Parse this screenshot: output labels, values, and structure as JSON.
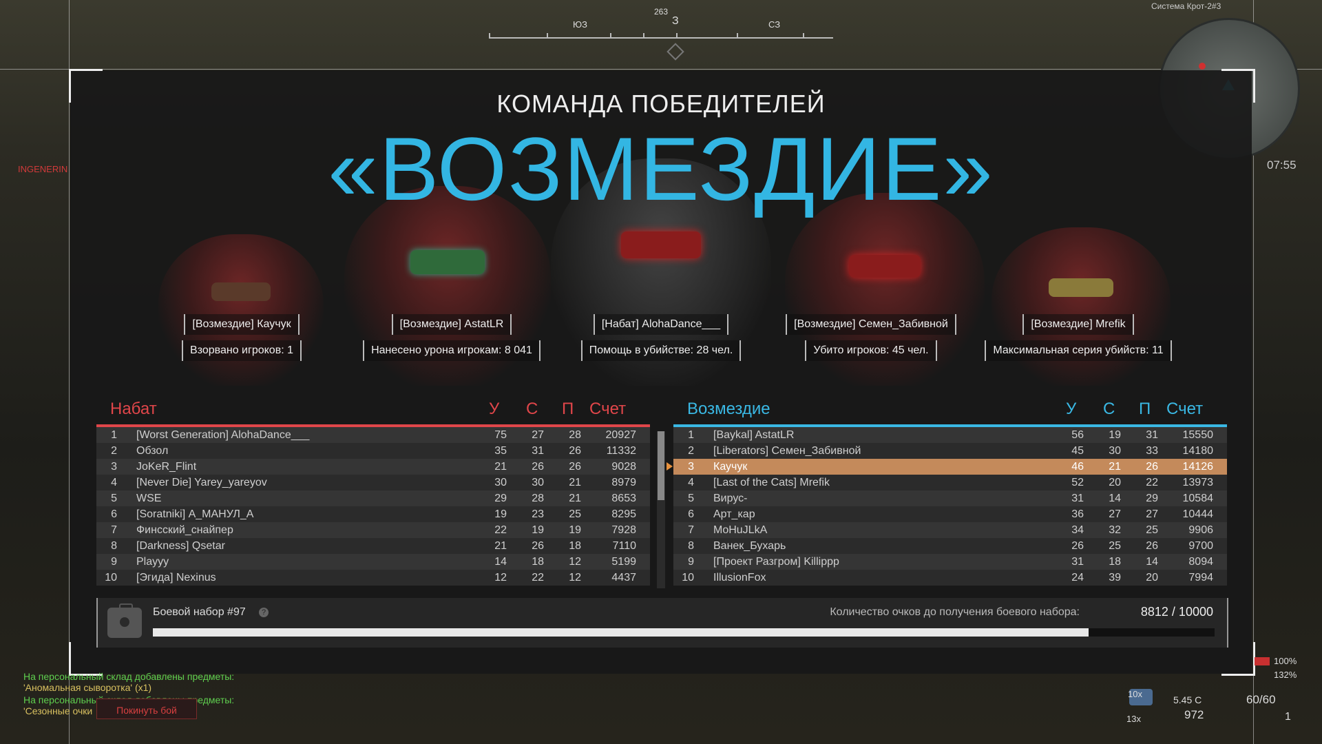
{
  "hud": {
    "compass": {
      "heading_deg": "263",
      "heading_label": "З",
      "left_label": "ЮЗ",
      "right_label": "СЗ"
    },
    "minimap_title": "Система Крот-2#3",
    "clock": "07:55",
    "side_label": "INGENERIN",
    "health_pct": "100%",
    "armor_pct": "132%",
    "grenade_count": "10x",
    "medkit_count": "13x",
    "ammo_type": "5.45 С",
    "ammo_reserve": "972",
    "ammo_mag": "60/60",
    "slot_count": "1"
  },
  "victory": {
    "subtitle": "КОМАНДА ПОБЕДИТЕЛЕЙ",
    "team": "«ВОЗМЕЗДИЕ»"
  },
  "highlights": [
    {
      "name": "[Возмездие] Каучук",
      "stat": "Взорвано игроков: 1"
    },
    {
      "name": "[Возмездие] AstatLR",
      "stat": "Нанесено урона игрокам: 8 041"
    },
    {
      "name": "[Набат] AlohaDance___",
      "stat": "Помощь в убийстве: 28 чел."
    },
    {
      "name": "[Возмездие] Семен_Забивной",
      "stat": "Убито игроков: 45 чел."
    },
    {
      "name": "[Возмездие] Mrefik",
      "stat": "Максимальная серия убийств: 11"
    }
  ],
  "columns": {
    "kills": "У",
    "deaths": "С",
    "assists": "П",
    "score": "Счет"
  },
  "teams": [
    {
      "name": "Набат",
      "color": "#e0464a",
      "rows": [
        {
          "rank": "1",
          "name": "[Worst Generation] AlohaDance___",
          "k": "75",
          "d": "27",
          "a": "28",
          "s": "20927"
        },
        {
          "rank": "2",
          "name": "Обзол",
          "k": "35",
          "d": "31",
          "a": "26",
          "s": "11332"
        },
        {
          "rank": "3",
          "name": "JoKeR_Flint",
          "k": "21",
          "d": "26",
          "a": "26",
          "s": "9028"
        },
        {
          "rank": "4",
          "name": "[Never Die] Yarey_yareyov",
          "k": "30",
          "d": "30",
          "a": "21",
          "s": "8979"
        },
        {
          "rank": "5",
          "name": "WSE",
          "k": "29",
          "d": "28",
          "a": "21",
          "s": "8653"
        },
        {
          "rank": "6",
          "name": "[Soratniki] А_МАНУЛ_А",
          "k": "19",
          "d": "23",
          "a": "25",
          "s": "8295"
        },
        {
          "rank": "7",
          "name": "Финсский_снайпер",
          "k": "22",
          "d": "19",
          "a": "19",
          "s": "7928"
        },
        {
          "rank": "8",
          "name": "[Darkness] Qsetar",
          "k": "21",
          "d": "26",
          "a": "18",
          "s": "7110"
        },
        {
          "rank": "9",
          "name": "Playyy",
          "k": "14",
          "d": "18",
          "a": "12",
          "s": "5199"
        },
        {
          "rank": "10",
          "name": "[Эгида] Nexinus",
          "k": "12",
          "d": "22",
          "a": "12",
          "s": "4437"
        }
      ]
    },
    {
      "name": "Возмездие",
      "color": "#3ab8e4",
      "rows": [
        {
          "rank": "1",
          "name": "[Baykal] AstatLR",
          "k": "56",
          "d": "19",
          "a": "31",
          "s": "15550"
        },
        {
          "rank": "2",
          "name": "[Liberators] Семен_Забивной",
          "k": "45",
          "d": "30",
          "a": "33",
          "s": "14180"
        },
        {
          "rank": "3",
          "name": "Каучук",
          "k": "46",
          "d": "21",
          "a": "26",
          "s": "14126",
          "me": true
        },
        {
          "rank": "4",
          "name": "[Last of the Cats] Mrefik",
          "k": "52",
          "d": "20",
          "a": "22",
          "s": "13973"
        },
        {
          "rank": "5",
          "name": "Вирус-",
          "k": "31",
          "d": "14",
          "a": "29",
          "s": "10584"
        },
        {
          "rank": "6",
          "name": "Арт_кар",
          "k": "36",
          "d": "27",
          "a": "27",
          "s": "10444"
        },
        {
          "rank": "7",
          "name": "MoHuJLkA",
          "k": "34",
          "d": "32",
          "a": "25",
          "s": "9906"
        },
        {
          "rank": "8",
          "name": "Ванек_Бухарь",
          "k": "26",
          "d": "25",
          "a": "26",
          "s": "9700"
        },
        {
          "rank": "9",
          "name": "[Проект Разгром] Killippp",
          "k": "31",
          "d": "18",
          "a": "14",
          "s": "8094"
        },
        {
          "rank": "10",
          "name": "IllusionFox",
          "k": "24",
          "d": "39",
          "a": "20",
          "s": "7994"
        }
      ]
    }
  ],
  "battle_kit": {
    "title": "Боевой набор #97",
    "help": "?",
    "progress_label": "Количество очков до получения боевого набора:",
    "progress_value": "8812 / 10000",
    "progress_fraction": 0.8812
  },
  "chat": [
    {
      "text": "На персональный склад добавлены предметы:",
      "color": "#5fcf4f"
    },
    {
      "text": "'Аномальная сыворотка' (x1)",
      "color": "#d8c060"
    },
    {
      "text": "На персональный склад добавлены предметы:",
      "color": "#5fcf4f"
    },
    {
      "text": "'Сезонные очки",
      "color": "#d8c060"
    }
  ],
  "leave_button": "Покинуть бой"
}
